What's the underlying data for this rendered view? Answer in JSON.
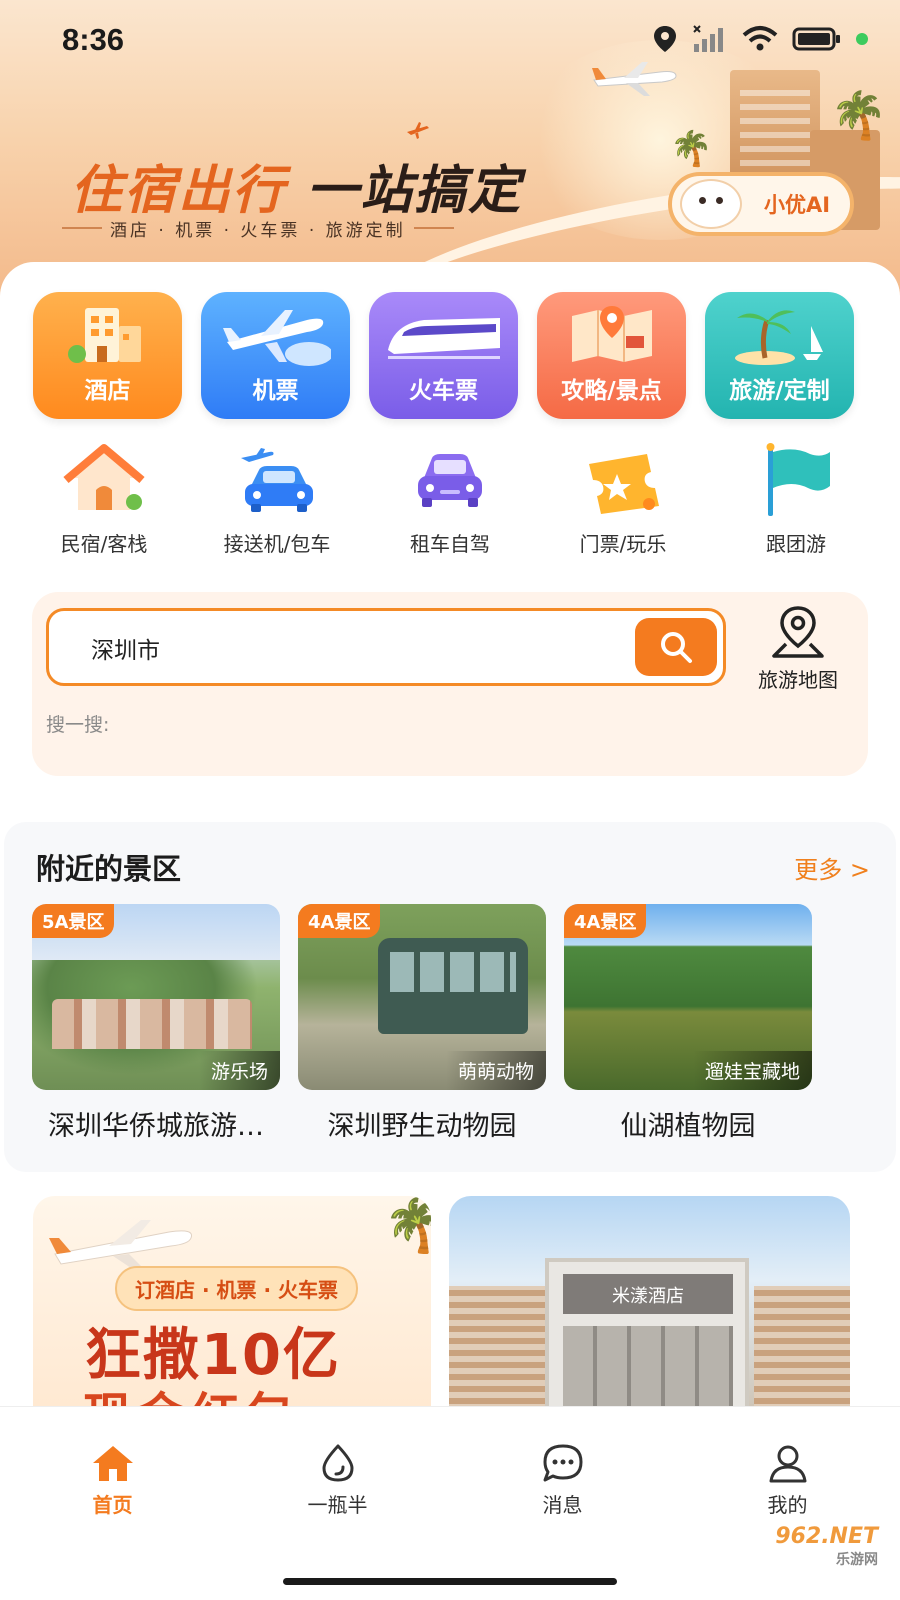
{
  "status_bar": {
    "time": "8:36"
  },
  "hero": {
    "title_part1": "住宿出行",
    "title_part2": "一站搞定",
    "subtitle": "酒店 · 机票 · 火车票 · 旅游定制",
    "ai_label": "小优AI"
  },
  "main_tiles": [
    {
      "label": "酒店",
      "icon": "hotel-icon"
    },
    {
      "label": "机票",
      "icon": "airplane-icon"
    },
    {
      "label": "火车票",
      "icon": "train-icon"
    },
    {
      "label": "攻略/景点",
      "icon": "map-guide-icon"
    },
    {
      "label": "旅游/定制",
      "icon": "palm-island-icon"
    }
  ],
  "sub_tiles": [
    {
      "label": "民宿/客栈",
      "icon": "house-icon"
    },
    {
      "label": "接送机/包车",
      "icon": "pickup-car-icon"
    },
    {
      "label": "租车自驾",
      "icon": "rental-car-icon"
    },
    {
      "label": "门票/玩乐",
      "icon": "ticket-icon"
    },
    {
      "label": "跟团游",
      "icon": "flag-icon"
    }
  ],
  "search": {
    "value": "深圳市",
    "map_label": "旅游地图",
    "hint": "搜一搜:"
  },
  "nearby": {
    "title": "附近的景区",
    "more": "更多 >",
    "spots": [
      {
        "badge": "5A景区",
        "tag": "游乐场",
        "name": "深圳华侨城旅游…"
      },
      {
        "badge": "4A景区",
        "tag": "萌萌动物",
        "name": "深圳野生动物园"
      },
      {
        "badge": "4A景区",
        "tag": "遛娃宝藏地",
        "name": "仙湖植物园"
      }
    ]
  },
  "promo": {
    "pill": "订酒店 · 机票 · 火车票",
    "headline": "狂撒10亿",
    "headline2": "现金红包",
    "hotel_sign": "米漾酒店"
  },
  "bottom_nav": [
    {
      "label": "首页",
      "icon": "home-icon",
      "active": true
    },
    {
      "label": "一瓶半",
      "icon": "drop-icon",
      "active": false
    },
    {
      "label": "消息",
      "icon": "message-icon",
      "active": false
    },
    {
      "label": "我的",
      "icon": "user-icon",
      "active": false
    }
  ],
  "watermark": {
    "text": "962.NET",
    "sub": "乐游网"
  },
  "colors": {
    "accent": "#f47b1f",
    "accent_text": "#f0801d"
  }
}
